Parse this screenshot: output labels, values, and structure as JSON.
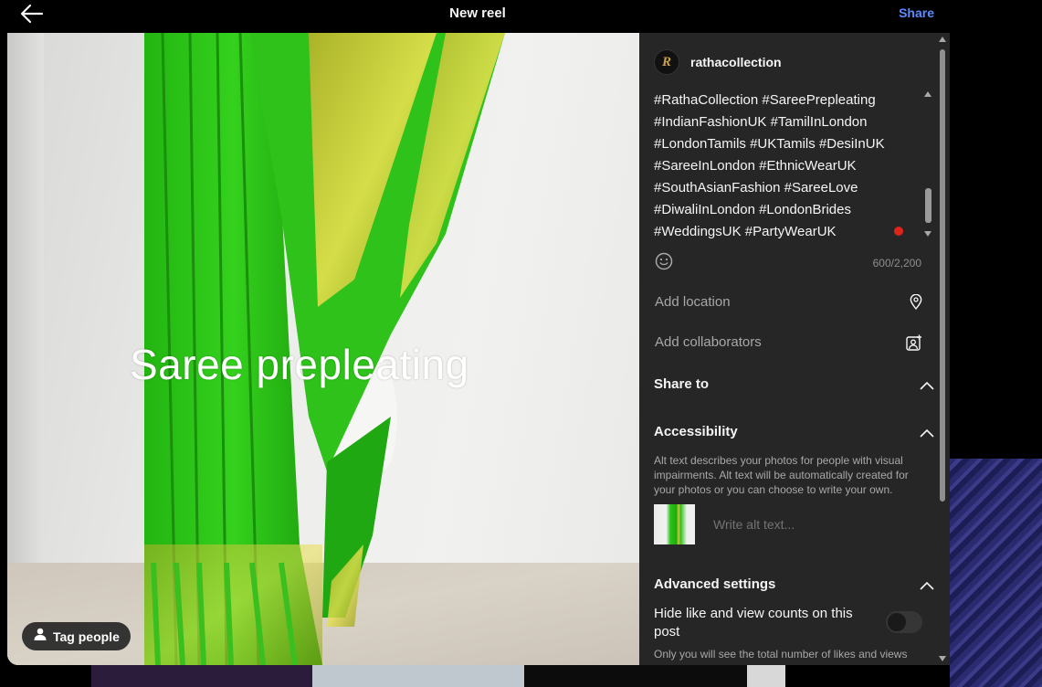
{
  "header": {
    "title": "New reel",
    "share_label": "Share"
  },
  "media": {
    "overlay_text": "Saree prepleating",
    "tag_people_label": "Tag people"
  },
  "panel": {
    "username": "rathacollection",
    "avatar_letter": "R",
    "caption_lines": [
      "#RathaCollection #SareePrepleating",
      "#IndianFashionUK #TamilInLondon",
      "#LondonTamils #UKTamils #DesiInUK",
      "#SareeInLondon #EthnicWearUK",
      "#SouthAsianFashion #SareeLove",
      "#DiwaliInLondon #LondonBrides",
      "#WeddingsUK #PartyWearUK"
    ],
    "char_count": "600/2,200",
    "add_location": "Add location",
    "add_collaborators": "Add collaborators",
    "share_to": "Share to",
    "accessibility": {
      "title": "Accessibility",
      "description": "Alt text describes your photos for people with visual impairments. Alt text will be automatically created for your photos or you can choose to write your own.",
      "alt_placeholder": "Write alt text..."
    },
    "advanced": {
      "title": "Advanced settings",
      "hide_counts_label": "Hide like and view counts on this post",
      "hide_counts_on": false,
      "note": "Only you will see the total number of likes and views"
    }
  },
  "colors": {
    "accent": "#5b8cff",
    "panel_bg": "#262626",
    "notification_dot": "#e0241b"
  }
}
